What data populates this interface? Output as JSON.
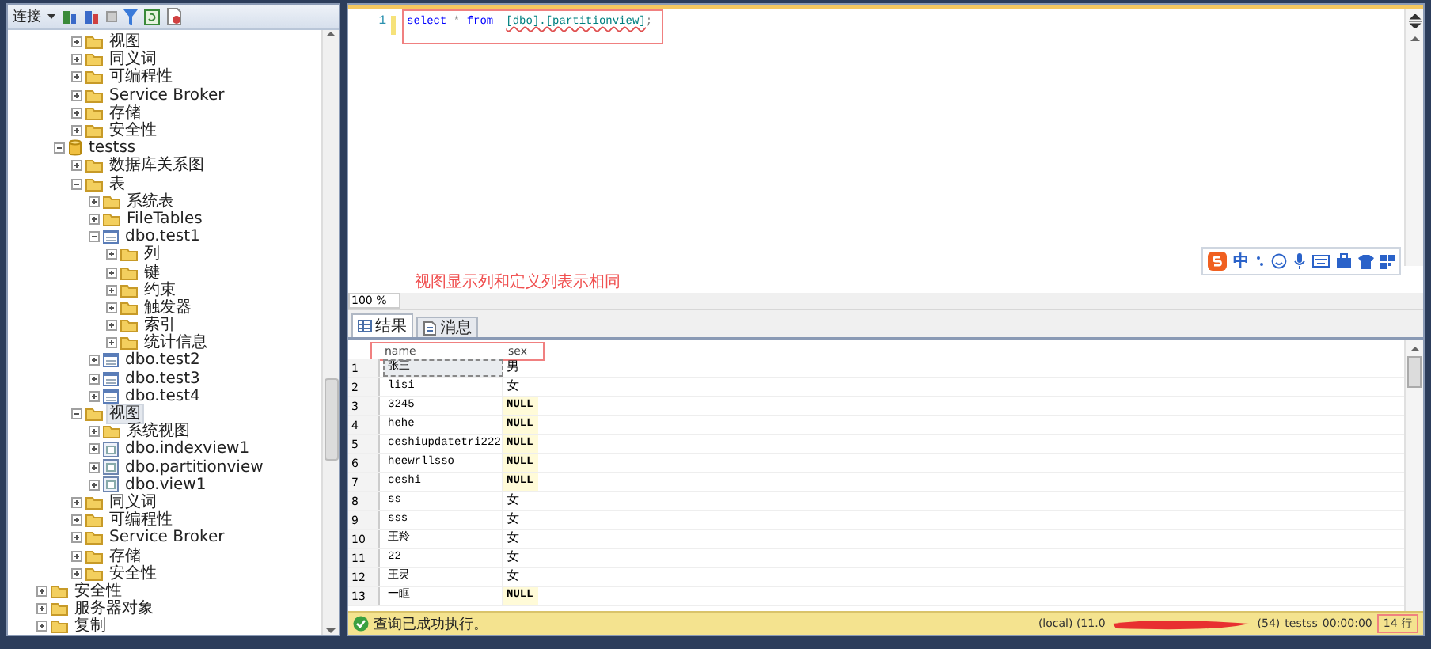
{
  "explorer": {
    "toolbar": {
      "connect_label": "连接"
    },
    "tree": [
      {
        "children": [
          {
            "children": [
              {
                "label": "视图",
                "kind": "folder",
                "expanded": false,
                "selected": false
              },
              {
                "label": "同义词",
                "kind": "folder",
                "expanded": false,
                "selected": false
              },
              {
                "label": "可编程性",
                "kind": "folder",
                "expanded": false,
                "selected": false
              },
              {
                "label": "Service Broker",
                "kind": "folder",
                "expanded": false,
                "selected": false
              },
              {
                "label": "存储",
                "kind": "folder",
                "expanded": false,
                "selected": false
              },
              {
                "label": "安全性",
                "kind": "folder",
                "expanded": false,
                "selected": false
              }
            ]
          },
          {
            "label": "testss",
            "kind": "database",
            "expanded": true,
            "selected": false,
            "children": [
              {
                "label": "数据库关系图",
                "kind": "folder",
                "expanded": false,
                "selected": false
              },
              {
                "label": "表",
                "kind": "folder",
                "expanded": true,
                "selected": false,
                "children": [
                  {
                    "label": "系统表",
                    "kind": "folder",
                    "expanded": false,
                    "selected": false
                  },
                  {
                    "label": "FileTables",
                    "kind": "folder",
                    "expanded": false,
                    "selected": false
                  },
                  {
                    "label": "dbo.test1",
                    "kind": "table",
                    "expanded": true,
                    "selected": false,
                    "children": [
                      {
                        "label": "列",
                        "kind": "folder",
                        "expanded": false,
                        "selected": false
                      },
                      {
                        "label": "键",
                        "kind": "folder",
                        "expanded": false,
                        "selected": false
                      },
                      {
                        "label": "约束",
                        "kind": "folder",
                        "expanded": false,
                        "selected": false
                      },
                      {
                        "label": "触发器",
                        "kind": "folder",
                        "expanded": false,
                        "selected": false
                      },
                      {
                        "label": "索引",
                        "kind": "folder",
                        "expanded": false,
                        "selected": false
                      },
                      {
                        "label": "统计信息",
                        "kind": "folder",
                        "expanded": false,
                        "selected": false
                      }
                    ]
                  },
                  {
                    "label": "dbo.test2",
                    "kind": "table",
                    "expanded": false,
                    "selected": false
                  },
                  {
                    "label": "dbo.test3",
                    "kind": "table",
                    "expanded": false,
                    "selected": false
                  },
                  {
                    "label": "dbo.test4",
                    "kind": "table",
                    "expanded": false,
                    "selected": false
                  }
                ]
              },
              {
                "label": "视图",
                "kind": "folder",
                "expanded": true,
                "selected": true,
                "children": [
                  {
                    "label": "系统视图",
                    "kind": "folder",
                    "expanded": false,
                    "selected": false
                  },
                  {
                    "label": "dbo.indexview1",
                    "kind": "view",
                    "expanded": false,
                    "selected": false
                  },
                  {
                    "label": "dbo.partitionview",
                    "kind": "view",
                    "expanded": false,
                    "selected": false
                  },
                  {
                    "label": "dbo.view1",
                    "kind": "view",
                    "expanded": false,
                    "selected": false
                  }
                ]
              },
              {
                "label": "同义词",
                "kind": "folder",
                "expanded": false,
                "selected": false
              },
              {
                "label": "可编程性",
                "kind": "folder",
                "expanded": false,
                "selected": false
              },
              {
                "label": "Service Broker",
                "kind": "folder",
                "expanded": false,
                "selected": false
              },
              {
                "label": "存储",
                "kind": "folder",
                "expanded": false,
                "selected": false
              },
              {
                "label": "安全性",
                "kind": "folder",
                "expanded": false,
                "selected": false
              }
            ]
          }
        ]
      },
      {
        "label": "安全性",
        "kind": "folder",
        "expanded": false,
        "selected": false
      },
      {
        "label": "服务器对象",
        "kind": "folder",
        "expanded": false,
        "selected": false
      },
      {
        "label": "复制",
        "kind": "folder",
        "expanded": false,
        "selected": false
      }
    ]
  },
  "editor": {
    "line_number": "1",
    "code": [
      {
        "text": "select",
        "kind": "keyword"
      },
      {
        "text": " * ",
        "kind": "operator"
      },
      {
        "text": "from",
        "kind": "keyword"
      },
      {
        "text": "[dbo].[partitionview]",
        "kind": "identifier"
      },
      {
        "text": ";",
        "kind": "operator"
      }
    ],
    "ime_label": "中"
  },
  "annotation": "视图显示列和定义列表示相同",
  "zoom": "100 %",
  "tabs": [
    {
      "label": "结果",
      "kind": "grid",
      "selected": true
    },
    {
      "label": "消息",
      "kind": "messages",
      "selected": false
    }
  ],
  "results": {
    "columns": [
      "name",
      "sex"
    ],
    "rows": [
      {
        "num": "1",
        "name": "张三",
        "sex": "男",
        "sex_null": false,
        "selected": true
      },
      {
        "num": "2",
        "name": "lisi",
        "sex": "女",
        "sex_null": false,
        "selected": false
      },
      {
        "num": "3",
        "name": "3245",
        "sex": "NULL",
        "sex_null": true,
        "selected": false
      },
      {
        "num": "4",
        "name": "hehe",
        "sex": "NULL",
        "sex_null": true,
        "selected": false
      },
      {
        "num": "5",
        "name": "ceshiupdatetri222",
        "sex": "NULL",
        "sex_null": true,
        "selected": false
      },
      {
        "num": "6",
        "name": "heewrllsso",
        "sex": "NULL",
        "sex_null": true,
        "selected": false
      },
      {
        "num": "7",
        "name": "ceshi",
        "sex": "NULL",
        "sex_null": true,
        "selected": false
      },
      {
        "num": "8",
        "name": "ss",
        "sex": "女",
        "sex_null": false,
        "selected": false
      },
      {
        "num": "9",
        "name": "sss",
        "sex": "女",
        "sex_null": false,
        "selected": false
      },
      {
        "num": "10",
        "name": "王羚",
        "sex": "女",
        "sex_null": false,
        "selected": false
      },
      {
        "num": "11",
        "name": "22",
        "sex": "女",
        "sex_null": false,
        "selected": false
      },
      {
        "num": "12",
        "name": "王灵",
        "sex": "女",
        "sex_null": false,
        "selected": false
      },
      {
        "num": "13",
        "name": "一眶",
        "sex": "NULL",
        "sex_null": true,
        "selected": false
      }
    ]
  },
  "status_bar": {
    "message": "查询已成功执行。",
    "server": "(local) (11.0",
    "session": "(54)",
    "database": "testss",
    "elapsed": "00:00:00",
    "row_count": "14 行"
  }
}
